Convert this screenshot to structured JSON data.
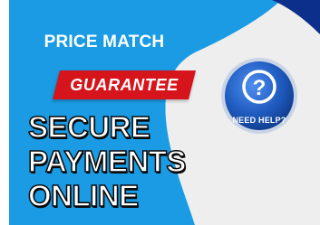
{
  "banner": {
    "price_match": "PRICE MATCH",
    "guarantee": "GUARANTEE",
    "headline": [
      "SECURE",
      "PAYMENTS",
      "ONLINE"
    ],
    "help_badge": {
      "symbol": "?",
      "label": "NEED HELP?",
      "icon": "question-mark-icon"
    }
  },
  "colors": {
    "brand_blue": "#1a9be3",
    "accent_red": "#d6141c",
    "badge_blue": "#1f5bbf",
    "dark_navy": "#0b2f8a",
    "light_panel": "#eeeeee"
  }
}
